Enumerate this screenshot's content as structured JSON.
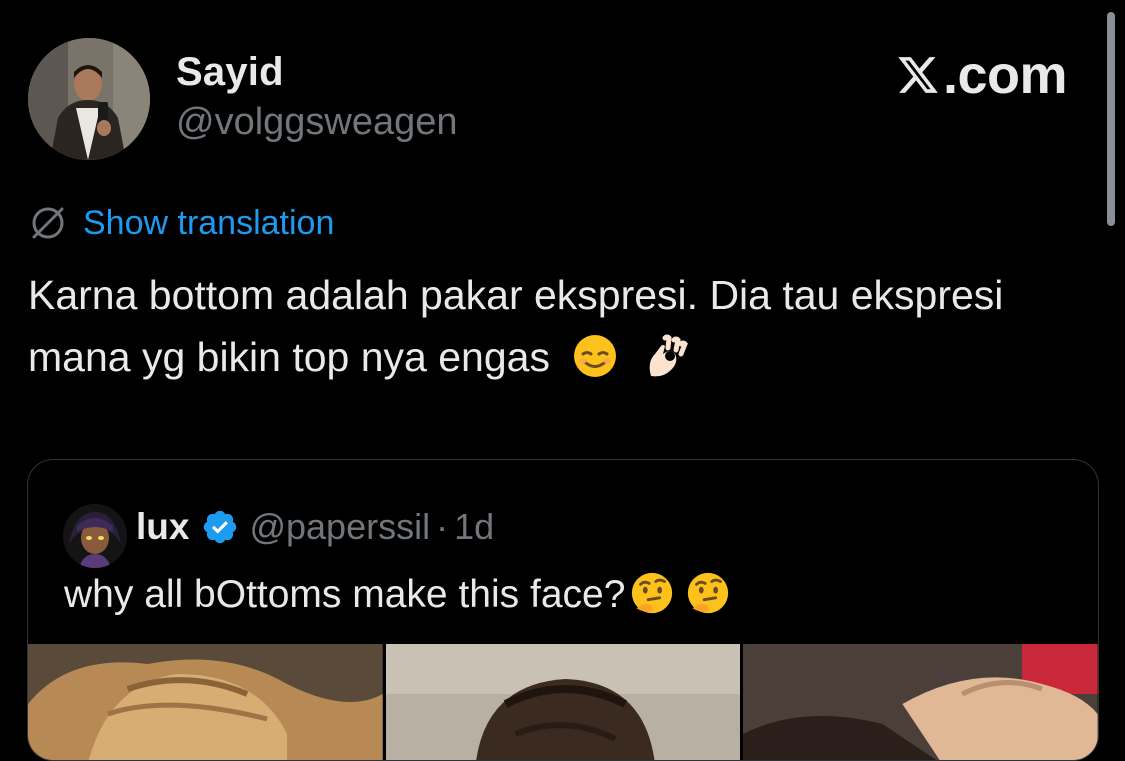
{
  "author": {
    "name": "Sayid",
    "handle": "@volggsweagen"
  },
  "brand": {
    "domain": ".com",
    "logo_icon": "x-logo-icon"
  },
  "translation": {
    "icon": "globe-slash-icon",
    "label": "Show translation"
  },
  "tweet": {
    "text": "Karna bottom adalah pakar ekspresi. Dia tau ekspresi mana yg bikin top nya engas",
    "emojis": [
      "relieved-face-emoji",
      "ok-hand-emoji"
    ]
  },
  "quote": {
    "name": "lux",
    "handle": "@paperssil",
    "separator": "·",
    "time": "1d",
    "text": "why all bOttoms make this face?",
    "emojis": [
      "thinking-face-emoji",
      "thinking-face-emoji"
    ],
    "media_count": 3
  },
  "colors": {
    "background": "#000000",
    "text": "#e7e9ea",
    "secondary": "#71767b",
    "link": "#1d9bf0",
    "border": "#2f3336"
  }
}
